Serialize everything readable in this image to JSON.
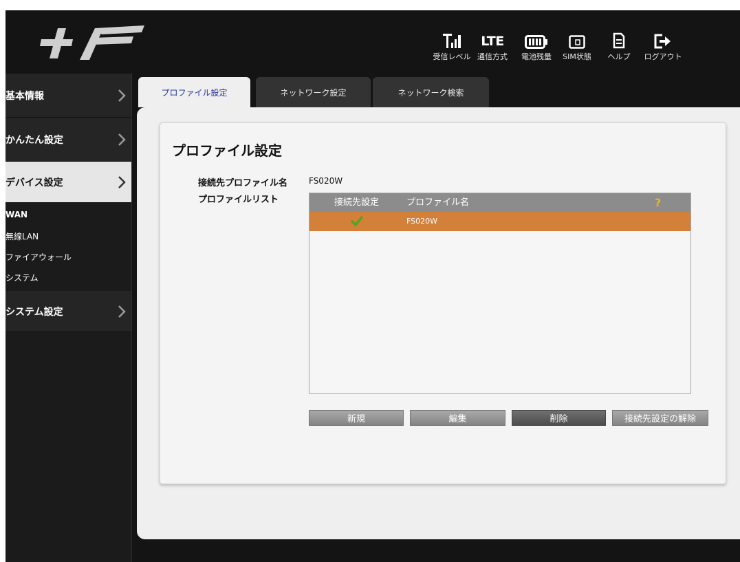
{
  "header": {
    "logo_text": "+F",
    "icons": [
      {
        "name": "signal-icon",
        "label": "受信レベル"
      },
      {
        "name": "lte-icon",
        "label": "通信方式",
        "glyph": "LTE"
      },
      {
        "name": "battery-icon",
        "label": "電池残量"
      },
      {
        "name": "sim-icon",
        "label": "SIM状態"
      },
      {
        "name": "help-icon",
        "label": "ヘルプ"
      },
      {
        "name": "logout-icon",
        "label": "ログアウト"
      }
    ]
  },
  "sidebar": {
    "menus": [
      {
        "label": "基本情報"
      },
      {
        "label": "かんたん設定"
      },
      {
        "label": "デバイス設定"
      },
      {
        "label": "システム設定"
      }
    ],
    "submenu": [
      "WAN",
      "無線LAN",
      "ファイアウォール",
      "システム"
    ]
  },
  "tabs": [
    {
      "label": "プロファイル設定"
    },
    {
      "label": "ネットワーク設定"
    },
    {
      "label": "ネットワーク検索"
    }
  ],
  "content": {
    "title": "プロファイル設定",
    "connection_profile_label": "接続先プロファイル名",
    "connection_profile_value": "FS020W",
    "profile_list_label": "プロファイルリスト",
    "table": {
      "headers": [
        "接続先設定",
        "プロファイル名"
      ],
      "help_icon": "?",
      "rows": [
        {
          "selected": true,
          "profile_name": "FS020W"
        }
      ]
    },
    "buttons": {
      "new": "新規",
      "edit": "編集",
      "delete": "削除",
      "unset": "接続先設定の解除"
    }
  },
  "colors": {
    "accent": "#d2803a",
    "active_tab_text": "#27339a",
    "check": "#5aa21d",
    "help": "#f0b323"
  }
}
